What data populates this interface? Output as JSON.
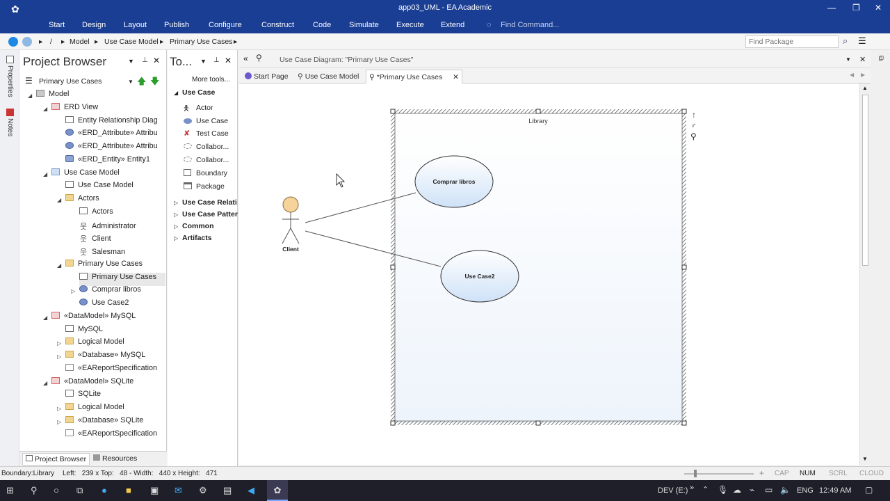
{
  "window": {
    "title": "app03_UML - EA Academic",
    "minimize": "—",
    "restore": "❐",
    "close": "✕"
  },
  "menu": [
    "Start",
    "Design",
    "Layout",
    "Publish",
    "Configure",
    "Construct",
    "Code",
    "Simulate",
    "Execute",
    "Extend"
  ],
  "find_command": "Find Command...",
  "breadcrumb": [
    "/",
    "Model",
    "Use Case Model",
    "Primary Use Cases"
  ],
  "find_package_placeholder": "Find Package",
  "side_labels": {
    "properties": "Properties",
    "notes": "Notes"
  },
  "project_browser": {
    "title": "Project Browser",
    "selector": "Primary Use Cases",
    "tree": [
      {
        "label": "Model",
        "icon": "model",
        "level": 0,
        "expander": "open"
      },
      {
        "label": "ERD View",
        "icon": "view",
        "level": 1,
        "expander": "open"
      },
      {
        "label": "Entity Relationship Diag",
        "icon": "diag",
        "level": 2,
        "expander": ""
      },
      {
        "label": "«ERD_Attribute» Attribu",
        "icon": "ellipse",
        "level": 2,
        "expander": ""
      },
      {
        "label": "«ERD_Attribute» Attribu",
        "icon": "ellipse",
        "level": 2,
        "expander": ""
      },
      {
        "label": "«ERD_Entity» Entity1",
        "icon": "entity",
        "level": 2,
        "expander": ""
      },
      {
        "label": "Use Case Model",
        "icon": "uc",
        "level": 1,
        "expander": "open"
      },
      {
        "label": "Use Case Model",
        "icon": "diag",
        "level": 2,
        "expander": ""
      },
      {
        "label": "Actors",
        "icon": "folder",
        "level": 2,
        "expander": "open"
      },
      {
        "label": "Actors",
        "icon": "diag",
        "level": 3,
        "expander": ""
      },
      {
        "label": "Administrator",
        "icon": "actor",
        "level": 3,
        "expander": ""
      },
      {
        "label": "Client",
        "icon": "actor",
        "level": 3,
        "expander": ""
      },
      {
        "label": "Salesman",
        "icon": "actor",
        "level": 3,
        "expander": ""
      },
      {
        "label": "Primary Use Cases",
        "icon": "folder",
        "level": 2,
        "expander": "open"
      },
      {
        "label": "Primary Use Cases",
        "icon": "diag",
        "level": 3,
        "expander": "",
        "selected": true
      },
      {
        "label": "Comprar libros",
        "icon": "ellipse",
        "level": 3,
        "expander": "closed"
      },
      {
        "label": "Use Case2",
        "icon": "ellipse",
        "level": 3,
        "expander": ""
      },
      {
        "label": "«DataModel» MySQL",
        "icon": "view",
        "level": 1,
        "expander": "open"
      },
      {
        "label": "MySQL",
        "icon": "diag",
        "level": 2,
        "expander": ""
      },
      {
        "label": "Logical Model",
        "icon": "folder",
        "level": 2,
        "expander": "closed"
      },
      {
        "label": "«Database» MySQL",
        "icon": "folder",
        "level": 2,
        "expander": "closed"
      },
      {
        "label": "«EAReportSpecification",
        "icon": "doc",
        "level": 2,
        "expander": ""
      },
      {
        "label": "«DataModel» SQLite",
        "icon": "view",
        "level": 1,
        "expander": "open"
      },
      {
        "label": "SQLite",
        "icon": "diag",
        "level": 2,
        "expander": ""
      },
      {
        "label": "Logical Model",
        "icon": "folder",
        "level": 2,
        "expander": "closed"
      },
      {
        "label": "«Database» SQLite",
        "icon": "folder",
        "level": 2,
        "expander": "closed"
      },
      {
        "label": "«EAReportSpecification",
        "icon": "doc",
        "level": 2,
        "expander": ""
      }
    ],
    "bottom_tabs": [
      "Project Browser",
      "Resources"
    ]
  },
  "toolbox": {
    "title": "To...",
    "more_tools": "More tools...",
    "section": "Use Case",
    "items": [
      "Actor",
      "Use Case",
      "Test Case",
      "Collabor...",
      "Collabor...",
      "Boundary",
      "Package"
    ],
    "groups": [
      "Use Case Relati",
      "Use Case Patter",
      "Common",
      "Artifacts"
    ]
  },
  "diagram": {
    "header": "Use Case Diagram: \"Primary Use Cases\"",
    "tabs": [
      "Start Page",
      "Use Case Model",
      "*Primary Use Cases"
    ],
    "boundary_label": "Library",
    "actor_label": "Client",
    "use_cases": [
      "Comprar libros",
      "Use Case2"
    ]
  },
  "status": {
    "element": "Boundary:Library",
    "geometry": "Left:   239 x Top:   48 - Width:   440 x Height:   471",
    "indicators": [
      "CAP",
      "NUM",
      "SCRL",
      "CLOUD"
    ]
  },
  "taskbar": {
    "drive": "DEV (E:)",
    "lang": "ENG",
    "time": "12:49 AM"
  }
}
